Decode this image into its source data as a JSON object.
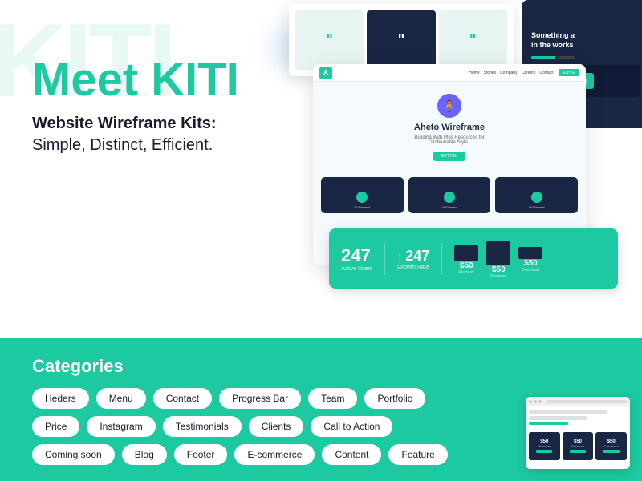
{
  "header": {
    "watermark": "KITI",
    "title": "Meet KITI",
    "subtitle_bold": "Website Wireframe Kits:",
    "subtitle_light": "Simple, Distinct, Efficient."
  },
  "mockup": {
    "dark_title": "Something a",
    "dark_subtitle": "in the works",
    "nav_items": [
      "Home",
      "Stories",
      "Company",
      "Careers",
      "Contact"
    ],
    "hero_title": "Aheto Wireframe",
    "hero_sub": "Building With Plus Resources for Unbeatable Style",
    "hero_btn": "BUTTON",
    "card_labels": [
      "UI Element",
      "UI Element",
      "UI Element"
    ],
    "stats_number": "247",
    "stats_number2": "247"
  },
  "bottom": {
    "categories_title": "Categories",
    "row1": [
      "Heders",
      "Menu",
      "Contact",
      "Progress Bar",
      "Team",
      "Portfolio"
    ],
    "row2": [
      "Price",
      "Instagram",
      "Testimonials",
      "Clients",
      "Call to Action"
    ],
    "row3": [
      "Coming soon",
      "Blog",
      "Footer",
      "E-commerce",
      "Content",
      "Feature"
    ]
  },
  "colors": {
    "teal": "#1cc9a0",
    "dark": "#1a2744",
    "white": "#ffffff"
  }
}
